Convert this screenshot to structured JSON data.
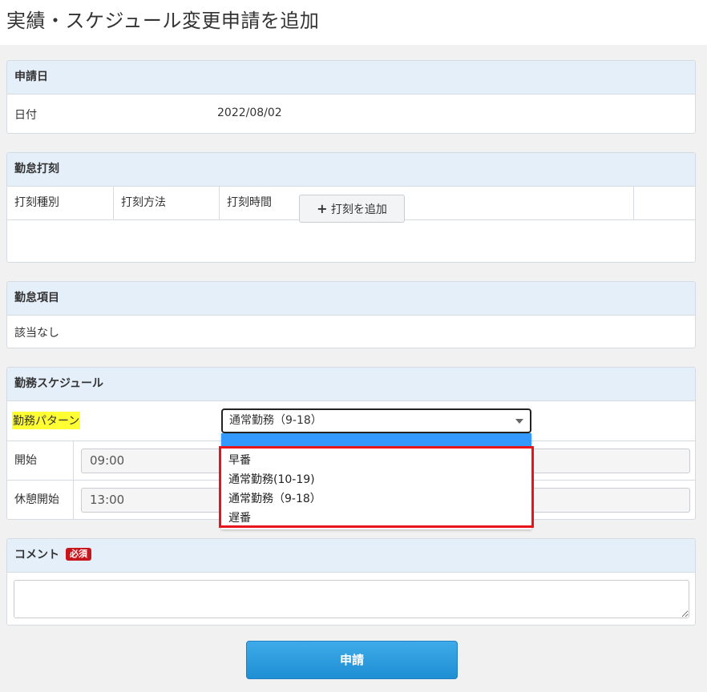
{
  "page": {
    "title": "実績・スケジュール変更申請を追加"
  },
  "request_date": {
    "header": "申請日",
    "date_label": "日付",
    "date_value": "2022/08/02"
  },
  "punch": {
    "header": "勤怠打刻",
    "columns": [
      "打刻種別",
      "打刻方法",
      "打刻時間"
    ],
    "add_button_icon": "plus-icon",
    "add_button_label": "打刻を追加"
  },
  "items": {
    "header": "勤怠項目",
    "value": "該当なし"
  },
  "schedule": {
    "header": "勤務スケジュール",
    "pattern_label": "勤務パターン",
    "pattern_selected": "通常勤務（9-18）",
    "pattern_options": [
      "早番",
      "通常勤務(10-19)",
      "通常勤務（9-18）",
      "遅番"
    ],
    "start_label": "開始",
    "start_value": "09:00",
    "break_label": "休憩開始",
    "break_value": "13:00"
  },
  "comment": {
    "header": "コメント",
    "required_badge": "必須",
    "value": ""
  },
  "submit": {
    "label": "申請"
  },
  "colors": {
    "accent": "#1f8fd4",
    "header_bg": "#e5effa",
    "highlight": "#ffff33",
    "dropdown_selected": "#3399ff",
    "annotation_red": "#e8141c",
    "required_red": "#c7161e"
  }
}
